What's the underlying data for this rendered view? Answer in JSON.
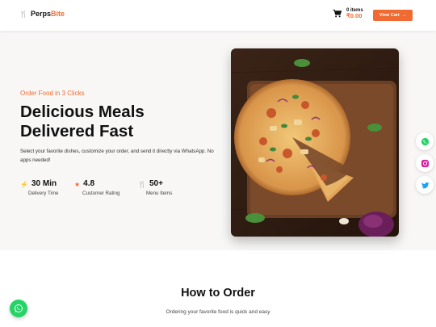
{
  "brand": {
    "name_part1": "Perps",
    "name_part2": "Bite"
  },
  "cart": {
    "count": "0 items",
    "total": "₹0.00",
    "button_label": "View Cart"
  },
  "hero": {
    "tagline": "Order Food in 3 Clicks",
    "headline_line1": "Delicious Meals",
    "headline_line2": "Delivered Fast",
    "description": "Select your favorite dishes, customize your order, and send it directly via WhatsApp. No apps needed!",
    "stats": [
      {
        "value": "30 Min",
        "label": "Delivery Time",
        "icon": "bolt-icon"
      },
      {
        "value": "4.8",
        "label": "Customer Rating",
        "icon": "star-icon"
      },
      {
        "value": "50+",
        "label": "Menu Items",
        "icon": "utensils-icon"
      }
    ]
  },
  "how_to_order": {
    "title": "How to Order",
    "subtitle": "Ordering your favorite food is quick and easy"
  },
  "colors": {
    "accent": "#ef6b33",
    "whatsapp": "#25d366",
    "twitter": "#1da1f2"
  }
}
